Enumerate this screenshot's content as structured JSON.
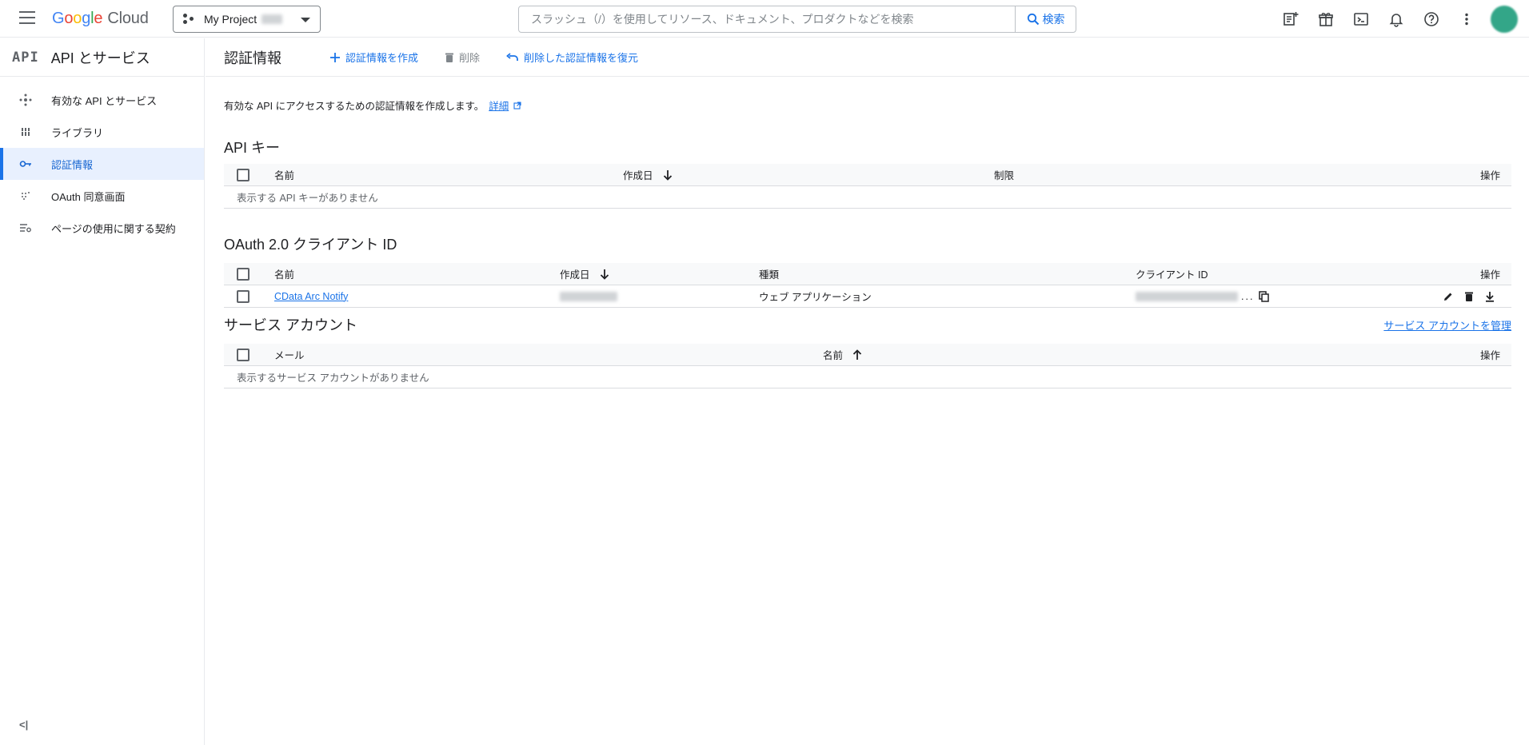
{
  "header": {
    "logo_google": "Google",
    "logo_cloud": "Cloud",
    "project_label": "My Project",
    "search_placeholder": "スラッシュ（/）を使用してリソース、ドキュメント、プロダクトなどを検索",
    "search_button": "検索",
    "icons": [
      "notes-icon",
      "gift-icon",
      "terminal-icon",
      "bell-icon",
      "help-icon",
      "more-vert-icon"
    ]
  },
  "sidebar": {
    "logo_text": "API",
    "title": "API とサービス",
    "items": [
      {
        "label": "有効な API とサービス",
        "icon": "api-hub-icon",
        "active": false
      },
      {
        "label": "ライブラリ",
        "icon": "library-icon",
        "active": false
      },
      {
        "label": "認証情報",
        "icon": "key-icon",
        "active": true
      },
      {
        "label": "OAuth 同意画面",
        "icon": "dots-grid-icon",
        "active": false
      },
      {
        "label": "ページの使用に関する契約",
        "icon": "settings-list-icon",
        "active": false
      }
    ],
    "collapse_label": "<|"
  },
  "toolbar": {
    "title": "認証情報",
    "create_label": "認証情報を作成",
    "delete_label": "削除",
    "restore_label": "削除した認証情報を復元"
  },
  "description": {
    "text": "有効な API にアクセスするための認証情報を作成します。",
    "link": "詳細"
  },
  "api_keys": {
    "title": "API キー",
    "columns": [
      "名前",
      "作成日",
      "制限",
      "操作"
    ],
    "empty": "表示する API キーがありません"
  },
  "oauth": {
    "title": "OAuth 2.0 クライアント ID",
    "columns": [
      "名前",
      "作成日",
      "種類",
      "クライアント ID",
      "操作"
    ],
    "rows": [
      {
        "name": "CData Arc Notify",
        "type": "ウェブ アプリケーション",
        "client_id_suffix": "..."
      }
    ]
  },
  "service_accounts": {
    "title": "サービス アカウント",
    "manage_link": "サービス アカウントを管理",
    "columns": [
      "メール",
      "名前",
      "操作"
    ],
    "empty": "表示するサービス アカウントがありません"
  },
  "colors": {
    "accent": "#1a73e8",
    "active_bg": "#e8f0fe",
    "avatar": "#33a688"
  }
}
